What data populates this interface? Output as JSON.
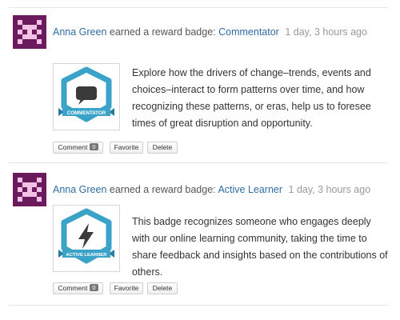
{
  "feed": [
    {
      "user": "Anna Green",
      "action": "earned a reward badge:",
      "badge_name": "Commentator",
      "timestamp": "1 day, 3 hours ago",
      "badge_icon": "speech-bubble-icon",
      "badge_ribbon": "COMMENTATOR",
      "description": "Explore how the drivers of change–trends, events and choices–interact to form patterns over time, and how recognizing these patterns, or eras, help us to foresee times of great disruption and opportunity.",
      "actions": {
        "comment": "Comment",
        "comment_count": "0",
        "favorite": "Favorite",
        "delete": "Delete"
      }
    },
    {
      "user": "Anna Green",
      "action": "earned a reward badge:",
      "badge_name": "Active Learner",
      "timestamp": "1 day, 3 hours ago",
      "badge_icon": "lightning-bolt-icon",
      "badge_ribbon": "ACTIVE LEARNER",
      "description": "This badge recognizes someone who engages deeply with our online learning community, taking the time to share feedback and insights based on the contributions of others.",
      "actions": {
        "comment": "Comment",
        "comment_count": "0",
        "favorite": "Favorite",
        "delete": "Delete"
      }
    }
  ],
  "colors": {
    "link": "#2e6da4",
    "badge_teal": "#3aa3c7",
    "badge_dark": "#3a3a3a",
    "avatar_bg": "#6b1a5c",
    "avatar_fg": "#f2c2e6"
  }
}
